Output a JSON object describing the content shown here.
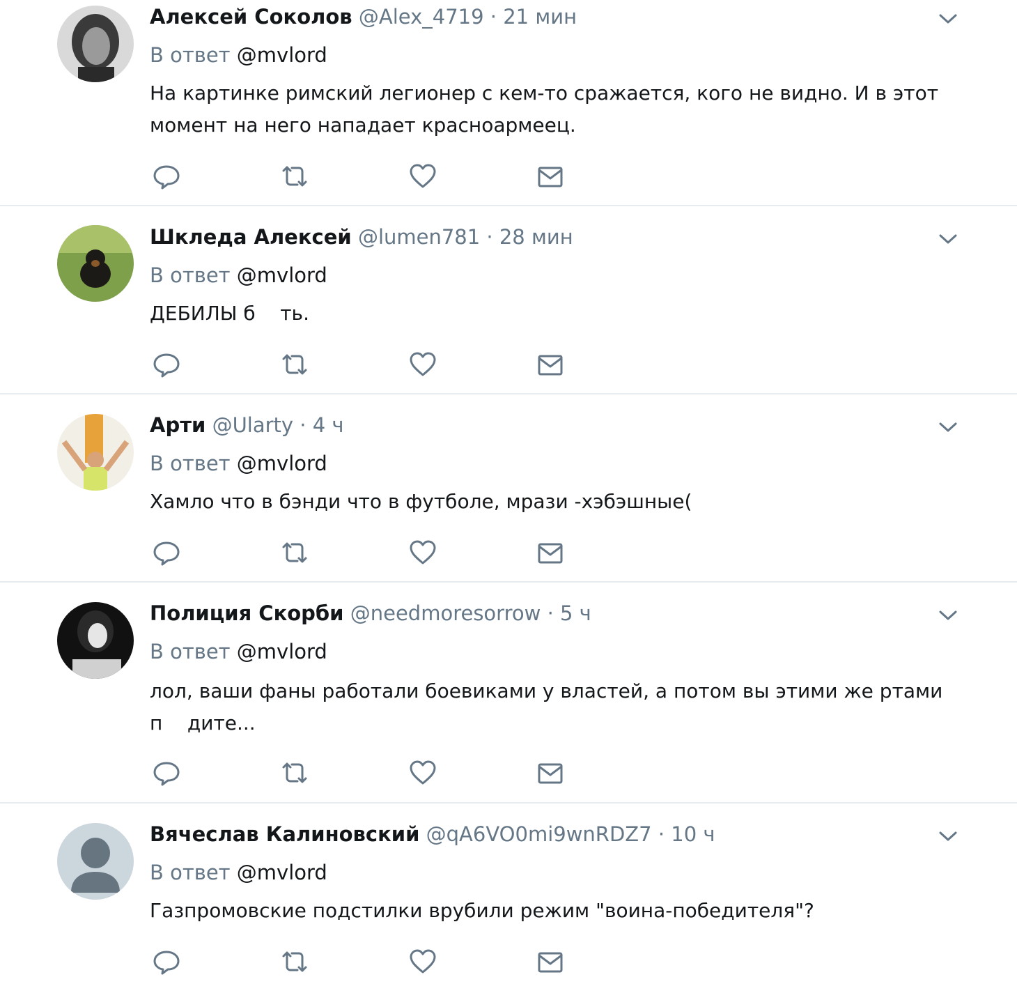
{
  "reply_label": "В ответ",
  "tweets": [
    {
      "name": "Алексей Соколов",
      "handle": "@Alex_4719",
      "separator": "·",
      "time": "21 мин",
      "reply_to": "@mvlord",
      "text": "На картинке римский легионер с кем-то сражается, кого не видно. И в этот момент на него нападает красноармеец."
    },
    {
      "name": "Шклeда Алексей",
      "handle": "@lumen781",
      "separator": "·",
      "time": "28 мин",
      "reply_to": "@mvlord",
      "text": "ДЕБИЛЫ б    ть."
    },
    {
      "name": "Арти",
      "handle": "@Ularty",
      "separator": "·",
      "time": "4 ч",
      "reply_to": "@mvlord",
      "text": "Хамло что в бэнди что в футболе, мрази -хэбэшные("
    },
    {
      "name": "Полиция Скорби",
      "handle": "@needmoresorrow",
      "separator": "·",
      "time": "5 ч",
      "reply_to": "@mvlord",
      "text": "лол, ваши фаны работали боевиками у властей, а потом вы этими же ртами п    дите..."
    },
    {
      "name": "Вячеслав Калиновский",
      "handle": "@qA6VO0mi9wnRDZ7",
      "separator": "·",
      "time": "10 ч",
      "reply_to": "@mvlord",
      "text": "Газпромовские подстилки врубили режим \"воина-победителя\"?"
    }
  ],
  "icons": {
    "reply": "reply-icon",
    "retweet": "retweet-icon",
    "like": "heart-icon",
    "message": "envelope-icon",
    "menu": "chevron-down-icon"
  },
  "colors": {
    "text": "#14171a",
    "secondary": "#657786",
    "icon": "#657786",
    "divider": "#e6ecf0"
  }
}
